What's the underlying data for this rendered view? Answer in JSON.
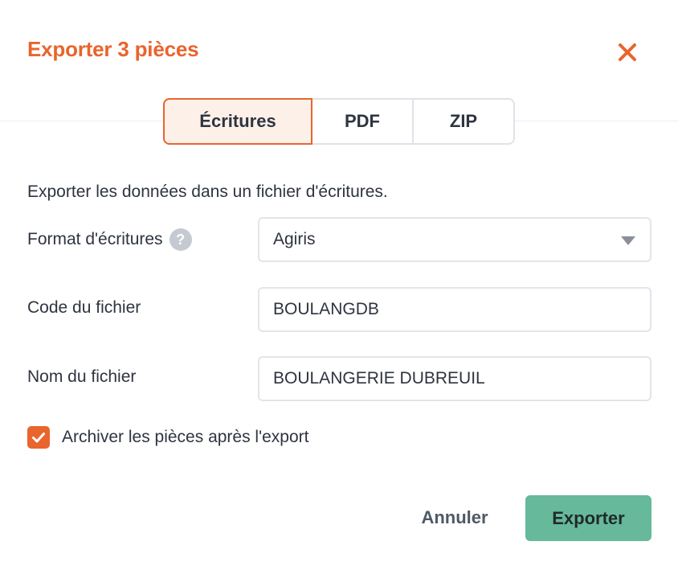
{
  "dialog": {
    "title": "Exporter 3 pièces",
    "close_icon": "close-icon"
  },
  "tabs": [
    {
      "label": "Écritures",
      "active": true
    },
    {
      "label": "PDF",
      "active": false
    },
    {
      "label": "ZIP",
      "active": false
    }
  ],
  "form": {
    "description": "Exporter les données dans un fichier d'écritures.",
    "format": {
      "label": "Format d'écritures",
      "help_icon": "question-circle-icon",
      "value": "Agiris"
    },
    "file_code": {
      "label": "Code du fichier",
      "value": "BOULANGDB"
    },
    "file_name": {
      "label": "Nom du fichier",
      "value": "BOULANGERIE DUBREUIL"
    },
    "archive": {
      "label": "Archiver les pièces après l'export",
      "checked": true
    }
  },
  "actions": {
    "cancel_label": "Annuler",
    "export_label": "Exporter"
  },
  "colors": {
    "accent": "#e8652d",
    "active_tab_bg": "#fdf0e9",
    "primary_button": "#66b99a",
    "border": "#dfe2e8"
  }
}
